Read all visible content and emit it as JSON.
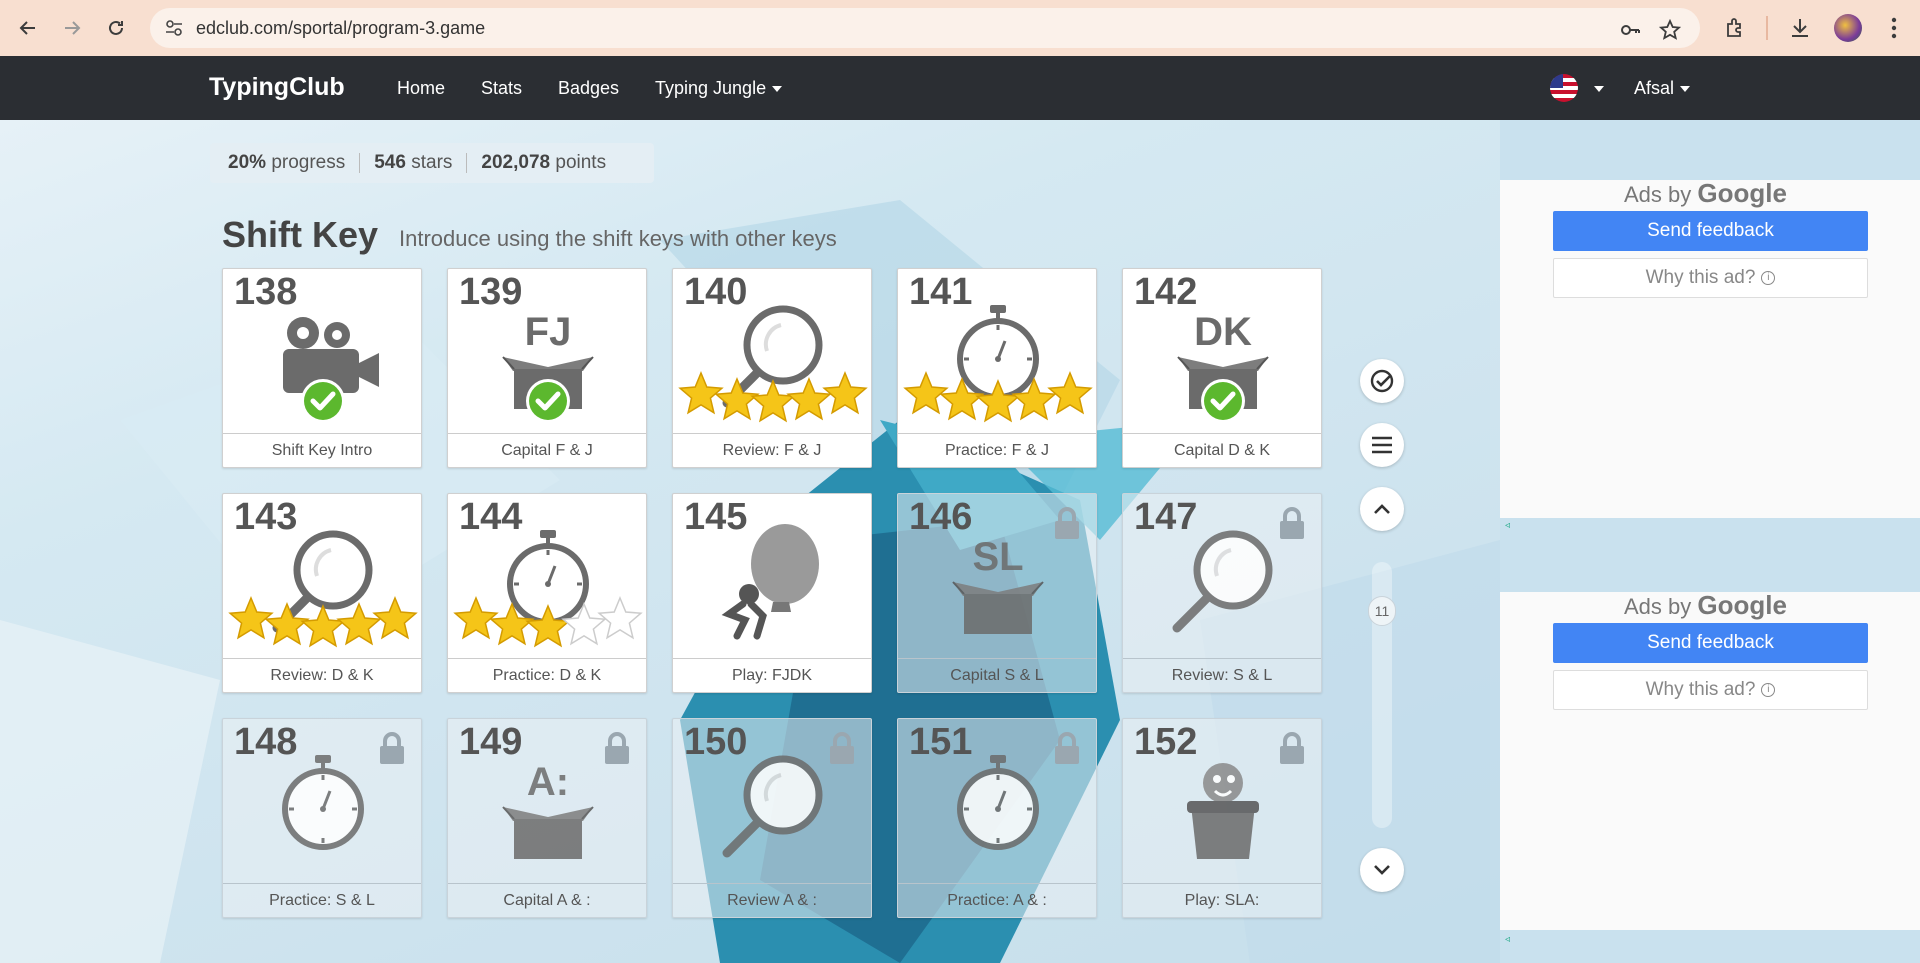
{
  "browser": {
    "url": "edclub.com/sportal/program-3.game"
  },
  "nav": {
    "brand": "TypingClub",
    "links": [
      "Home",
      "Stats",
      "Badges",
      "Typing Jungle"
    ],
    "user": "Afsal"
  },
  "progress": {
    "percent": "20%",
    "percent_label": "progress",
    "stars": "546",
    "stars_label": "stars",
    "points": "202,078",
    "points_label": "points"
  },
  "section": {
    "title": "Shift Key",
    "subtitle": "Introduce using the shift keys with other keys"
  },
  "lessons": [
    {
      "num": "138",
      "label": "Shift Key Intro",
      "icon": "video-camera-icon",
      "status": "done",
      "stars": 0,
      "locked": false
    },
    {
      "num": "139",
      "label": "Capital F & J",
      "icon": "box-icon",
      "box_text": "FJ",
      "status": "done",
      "stars": 0,
      "locked": false
    },
    {
      "num": "140",
      "label": "Review: F & J",
      "icon": "magnifier-icon",
      "status": "stars",
      "stars": 5,
      "locked": false
    },
    {
      "num": "141",
      "label": "Practice: F & J",
      "icon": "stopwatch-icon",
      "status": "stars",
      "stars": 5,
      "locked": false
    },
    {
      "num": "142",
      "label": "Capital D & K",
      "icon": "box-icon",
      "box_text": "DK",
      "status": "done",
      "stars": 0,
      "locked": false
    },
    {
      "num": "143",
      "label": "Review: D & K",
      "icon": "magnifier-icon",
      "status": "stars",
      "stars": 5,
      "locked": false
    },
    {
      "num": "144",
      "label": "Practice: D & K",
      "icon": "stopwatch-icon",
      "status": "stars",
      "stars": 3,
      "locked": false
    },
    {
      "num": "145",
      "label": "Play: FJDK",
      "icon": "balloon-game-icon",
      "status": "none",
      "stars": 0,
      "locked": false
    },
    {
      "num": "146",
      "label": "Capital S & L",
      "icon": "box-icon",
      "box_text": "SL",
      "status": "none",
      "stars": 0,
      "locked": true
    },
    {
      "num": "147",
      "label": "Review: S & L",
      "icon": "magnifier-icon",
      "status": "none",
      "stars": 0,
      "locked": true
    },
    {
      "num": "148",
      "label": "Practice: S & L",
      "icon": "stopwatch-icon",
      "status": "none",
      "stars": 0,
      "locked": true
    },
    {
      "num": "149",
      "label": "Capital A & :",
      "icon": "box-icon",
      "box_text": "A:",
      "status": "none",
      "stars": 0,
      "locked": true
    },
    {
      "num": "150",
      "label": "Review A & :",
      "icon": "magnifier-icon",
      "status": "none",
      "stars": 0,
      "locked": true
    },
    {
      "num": "151",
      "label": "Practice: A & :",
      "icon": "stopwatch-icon",
      "status": "none",
      "stars": 0,
      "locked": true
    },
    {
      "num": "152",
      "label": "Play: SLA:",
      "icon": "pot-game-icon",
      "status": "none",
      "stars": 0,
      "locked": true
    }
  ],
  "side": {
    "level_badge": "11"
  },
  "ads": [
    {
      "title_prefix": "Ads by",
      "title_brand": "Google",
      "send": "Send feedback",
      "why": "Why this ad?"
    },
    {
      "title_prefix": "Ads by",
      "title_brand": "Google",
      "send": "Send feedback",
      "why": "Why this ad?"
    }
  ],
  "colors": {
    "nav_bg": "#2b2e33",
    "accent_blue": "#4285f4",
    "check_green": "#5cb82e",
    "star_gold": "#f5c518"
  }
}
